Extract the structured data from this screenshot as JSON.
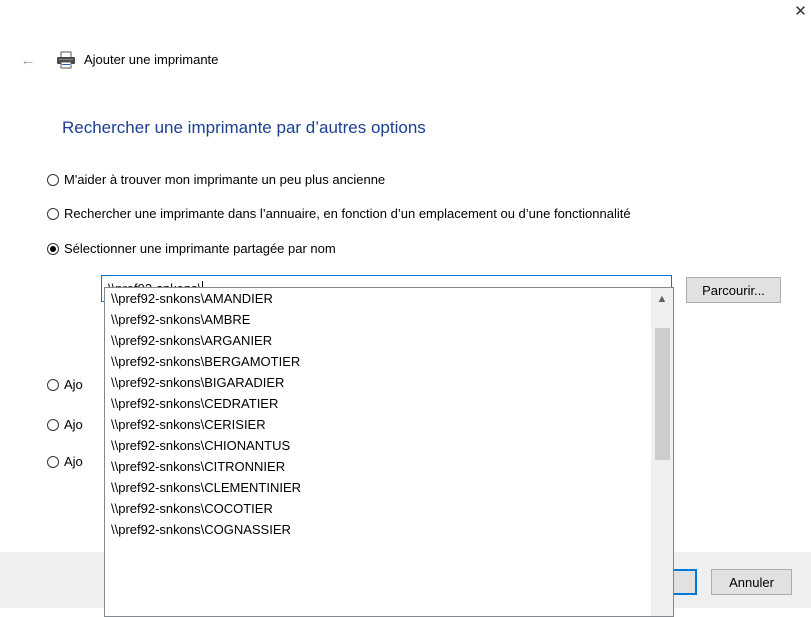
{
  "window": {
    "close_glyph": "✕",
    "back_glyph": "←",
    "title": "Ajouter une imprimante"
  },
  "heading": "Rechercher une imprimante par d’autres options",
  "options": [
    {
      "label": "M'aider à trouver mon imprimante un peu plus ancienne",
      "checked": false
    },
    {
      "label": "Rechercher une imprimante dans l’annuaire, en fonction d’un emplacement ou d’une fonctionnalité",
      "checked": false
    },
    {
      "label": "Sélectionner une imprimante partagée par nom",
      "checked": true
    },
    {
      "label": "Ajo",
      "checked": false
    },
    {
      "label": "Ajo",
      "checked": false
    },
    {
      "label": "Ajo",
      "checked": false
    }
  ],
  "share_input": {
    "value": "\\\\pref92-snkons\\"
  },
  "browse_label": "Parcourir...",
  "suggestions": [
    "\\\\pref92-snkons\\AMANDIER",
    "\\\\pref92-snkons\\AMBRE",
    "\\\\pref92-snkons\\ARGANIER",
    "\\\\pref92-snkons\\BERGAMOTIER",
    "\\\\pref92-snkons\\BIGARADIER",
    "\\\\pref92-snkons\\CEDRATIER",
    "\\\\pref92-snkons\\CERISIER",
    "\\\\pref92-snkons\\CHIONANTUS",
    "\\\\pref92-snkons\\CITRONNIER",
    "\\\\pref92-snkons\\CLEMENTINIER",
    "\\\\pref92-snkons\\COCOTIER",
    "\\\\pref92-snkons\\COGNASSIER"
  ],
  "footer": {
    "cancel_label": "Annuler"
  },
  "colors": {
    "heading": "#1c3f94",
    "focus": "#0078d7"
  }
}
